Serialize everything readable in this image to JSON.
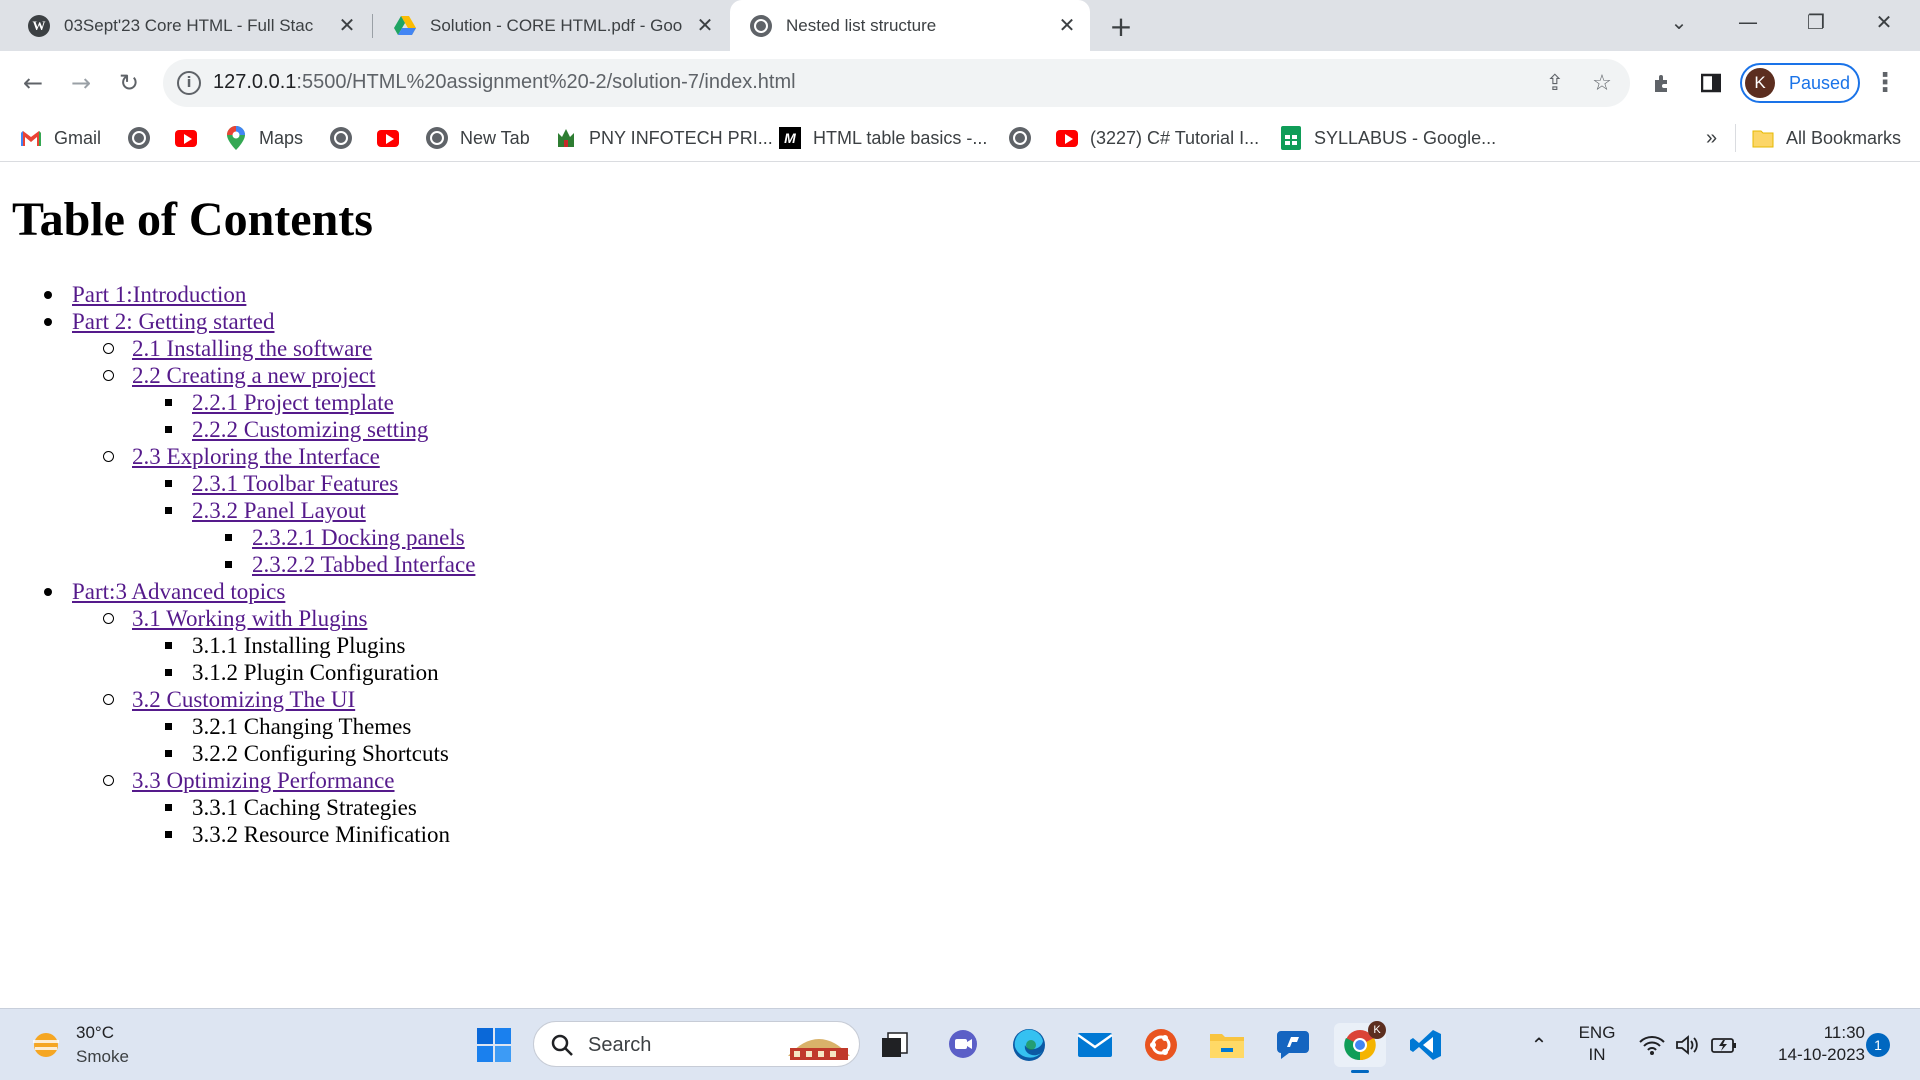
{
  "tabs": [
    {
      "title": "03Sept'23 Core HTML - Full Stac",
      "icon": "wordpress-icon",
      "active": false
    },
    {
      "title": "Solution - CORE HTML.pdf - Goo",
      "icon": "google-drive-icon",
      "active": false
    },
    {
      "title": "Nested list structure",
      "icon": "globe-icon",
      "active": true
    }
  ],
  "address_bar": {
    "url_host": "127.0.0.1",
    "url_rest": ":5500/HTML%20assignment%20-2/solution-7/index.html"
  },
  "profile": {
    "initial": "K",
    "status": "Paused"
  },
  "bookmarks": [
    {
      "label": "Gmail",
      "icon": "gmail-icon"
    },
    {
      "label": "",
      "icon": "globe-icon"
    },
    {
      "label": "",
      "icon": "youtube-icon"
    },
    {
      "label": "Maps",
      "icon": "maps-icon"
    },
    {
      "label": "",
      "icon": "globe-icon"
    },
    {
      "label": "",
      "icon": "youtube-icon"
    },
    {
      "label": "New Tab",
      "icon": "globe-icon"
    },
    {
      "label": "PNY INFOTECH PRI...",
      "icon": "pny-icon"
    },
    {
      "label": "HTML table basics -...",
      "icon": "mdn-icon"
    },
    {
      "label": "",
      "icon": "globe-icon"
    },
    {
      "label": "(3227) C# Tutorial I...",
      "icon": "youtube-icon"
    },
    {
      "label": "SYLLABUS - Google...",
      "icon": "google-sheets-icon"
    }
  ],
  "all_bookmarks": "All Bookmarks",
  "page": {
    "heading": "Table of Contents",
    "items": [
      {
        "text": "Part 1:Introduction",
        "level": 0,
        "link": true
      },
      {
        "text": "Part 2: Getting started",
        "level": 0,
        "link": true
      },
      {
        "text": "2.1 Installing the software",
        "level": 1,
        "link": true
      },
      {
        "text": "2.2 Creating a new project",
        "level": 1,
        "link": true
      },
      {
        "text": "2.2.1 Project template",
        "level": 2,
        "link": true
      },
      {
        "text": "2.2.2 Customizing setting",
        "level": 2,
        "link": true
      },
      {
        "text": "2.3 Exploring the Interface",
        "level": 1,
        "link": true
      },
      {
        "text": "2.3.1 Toolbar Features",
        "level": 2,
        "link": true
      },
      {
        "text": "2.3.2 Panel Layout",
        "level": 2,
        "link": true
      },
      {
        "text": "2.3.2.1 Docking panels",
        "level": 3,
        "link": true
      },
      {
        "text": "2.3.2.2 Tabbed Interface",
        "level": 3,
        "link": true
      },
      {
        "text": "Part:3 Advanced topics",
        "level": 0,
        "link": true
      },
      {
        "text": "3.1 Working with Plugins",
        "level": 1,
        "link": true
      },
      {
        "text": "3.1.1 Installing Plugins",
        "level": 2,
        "link": false
      },
      {
        "text": "3.1.2 Plugin Configuration",
        "level": 2,
        "link": false
      },
      {
        "text": "3.2 Customizing The UI",
        "level": 1,
        "link": true
      },
      {
        "text": "3.2.1 Changing Themes",
        "level": 2,
        "link": false
      },
      {
        "text": "3.2.2 Configuring Shortcuts",
        "level": 2,
        "link": false
      },
      {
        "text": "3.3 Optimizing Performance",
        "level": 1,
        "link": true
      },
      {
        "text": "3.3.1 Caching Strategies",
        "level": 2,
        "link": false
      },
      {
        "text": "3.3.2 Resource Minification",
        "level": 2,
        "link": false
      }
    ]
  },
  "taskbar": {
    "weather_temp": "30°C",
    "weather_condition": "Smoke",
    "search_label": "Search",
    "language_top": "ENG",
    "language_bottom": "IN",
    "time": "11:30",
    "date": "14-10-2023",
    "notification_count": "1",
    "profile_badge": "K"
  },
  "colors": {
    "tabstrip": "#dee1e6",
    "link_visited": "#551a8b",
    "accent": "#1a73e8",
    "taskbar": "#dde5f2"
  }
}
